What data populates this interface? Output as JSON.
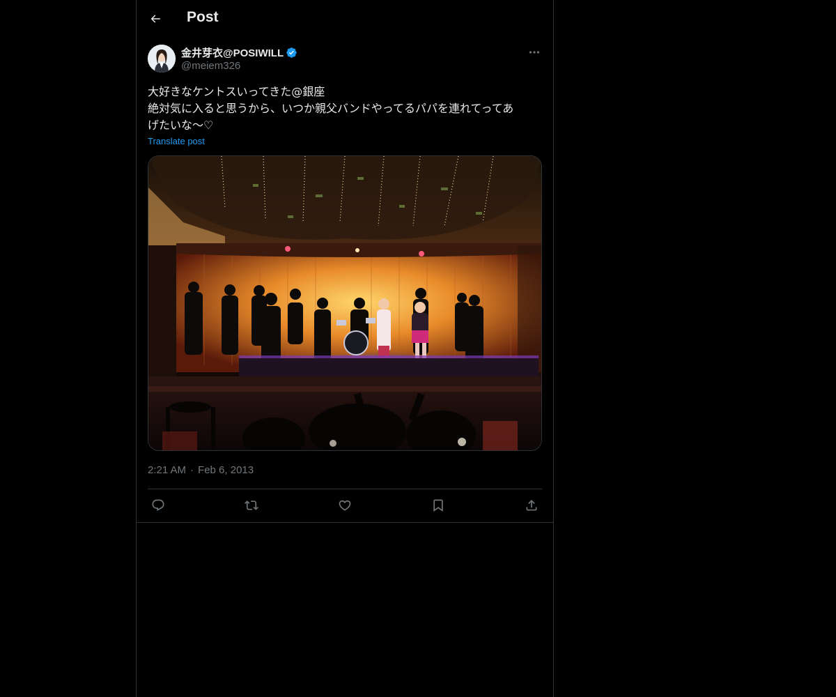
{
  "header": {
    "back_icon": "arrow-left-icon",
    "title": "Post"
  },
  "post": {
    "author": {
      "display_name": "金井芽衣@POSIWILL",
      "handle": "@meiem326",
      "verified": true,
      "verified_icon": "verified-badge-icon"
    },
    "more_icon": "more-horizontal-icon",
    "text_lines": [
      "大好きなケントスいってきた@銀座",
      "絶対気に入ると思うから、いつか親父バンドやってるパパを連れてってあ",
      "げたいな〜♡"
    ],
    "translate_label": "Translate post",
    "media": {
      "type": "photo",
      "description_icon": "photo-icon"
    },
    "time": "2:21 AM",
    "separator": "·",
    "date": "Feb 6, 2013",
    "actions": [
      {
        "name": "reply",
        "icon": "reply-icon"
      },
      {
        "name": "repost",
        "icon": "repost-icon"
      },
      {
        "name": "like",
        "icon": "heart-icon"
      },
      {
        "name": "bookmark",
        "icon": "bookmark-icon"
      },
      {
        "name": "share",
        "icon": "share-icon"
      }
    ]
  },
  "colors": {
    "background": "#000000",
    "text_primary": "#e7e9ea",
    "text_secondary": "#71767b",
    "accent": "#1d9bf0",
    "border": "#2f3336"
  }
}
